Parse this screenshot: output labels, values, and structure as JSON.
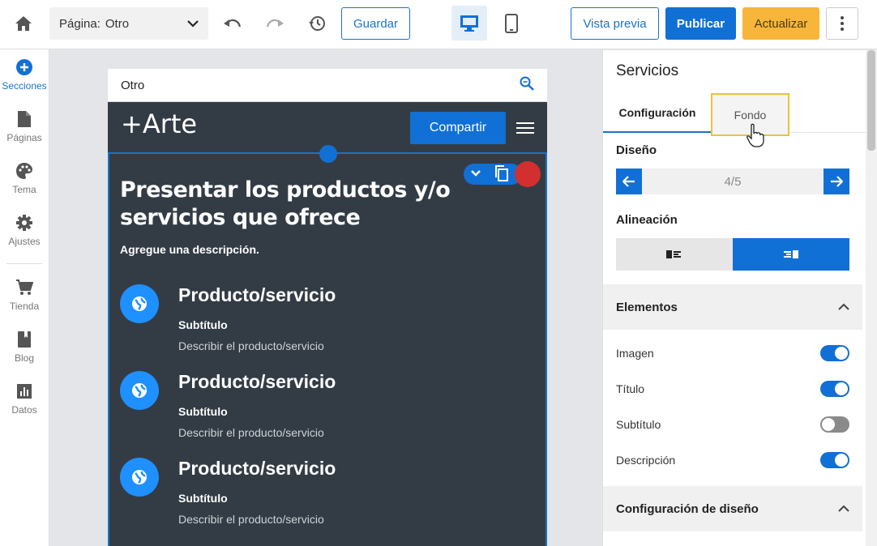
{
  "toolbar": {
    "page_label": "Página:",
    "page_value": "Otro",
    "save_label": "Guardar",
    "preview_label": "Vista previa",
    "publish_label": "Publicar",
    "update_label": "Actualizar"
  },
  "sidebar": {
    "items": [
      {
        "label": "Secciones",
        "icon": "plus-circle-icon"
      },
      {
        "label": "Páginas",
        "icon": "page-icon"
      },
      {
        "label": "Tema",
        "icon": "palette-icon"
      },
      {
        "label": "Ajustes",
        "icon": "gear-icon"
      },
      {
        "label": "Tienda",
        "icon": "cart-icon"
      },
      {
        "label": "Blog",
        "icon": "book-icon"
      },
      {
        "label": "Datos",
        "icon": "chart-icon"
      }
    ]
  },
  "site": {
    "page_name": "Otro",
    "logo": "+Arte",
    "share_label": "Compartir",
    "section_title": "Presentar los productos y/o servicios que ofrece",
    "section_desc": "Agregue una descripción.",
    "products": [
      {
        "title": "Producto/servicio",
        "subtitle": "Subtítulo",
        "desc": "Describir el producto/servicio"
      },
      {
        "title": "Producto/servicio",
        "subtitle": "Subtítulo",
        "desc": "Describir el producto/servicio"
      },
      {
        "title": "Producto/servicio",
        "subtitle": "Subtítulo",
        "desc": "Describir el producto/servicio"
      }
    ]
  },
  "panel": {
    "title": "Servicios",
    "tabs": [
      {
        "label": "Configuración"
      },
      {
        "label": "Fondo"
      }
    ],
    "design_label": "Diseño",
    "design_count": "4/5",
    "align_label": "Alineación",
    "elements_label": "Elementos",
    "toggles": [
      {
        "label": "Imagen",
        "on": true
      },
      {
        "label": "Título",
        "on": true
      },
      {
        "label": "Subtítulo",
        "on": false
      },
      {
        "label": "Descripción",
        "on": true
      }
    ],
    "design_config_label": "Configuración de diseño"
  },
  "colors": {
    "accent": "#1170d5",
    "update": "#f7b539",
    "section_bg": "#333c45",
    "delete": "#d32f2f",
    "highlight": "#e9c43a"
  }
}
